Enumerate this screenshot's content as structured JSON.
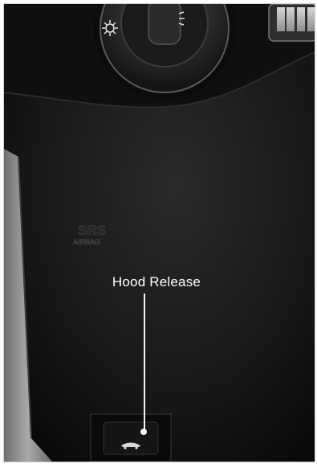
{
  "image": {
    "subject": "vehicle lower dashboard panel with hood release lever",
    "callout": {
      "label": "Hood Release"
    },
    "embossed_text": {
      "line1": "SRS",
      "line2": "AIRBAG"
    },
    "icons": [
      "headlamp-switch-icon",
      "light-sun-icon",
      "car-hood-icon"
    ],
    "colors": {
      "panel": "#1a1a1a",
      "trim": "#8a8a8a",
      "label": "#ffffff"
    }
  }
}
